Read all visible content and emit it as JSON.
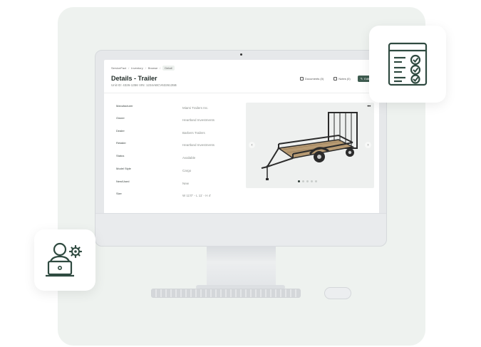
{
  "breadcrumb": [
    "ServiceFact",
    "Inventory",
    "Browse",
    "Detail"
  ],
  "page": {
    "title": "Details - Trailer",
    "subtitle": "Unit ID: 4326-1356   VIN: 1234ABCV6326135B"
  },
  "actions": {
    "documents": "Documents (0)",
    "notes": "Notes (0)",
    "edit": "Edit"
  },
  "fields": [
    {
      "label": "Manufacturer",
      "value": "Miami Trailers Inc."
    },
    {
      "label": "Owner",
      "value": "Heartland Investments"
    },
    {
      "label": "Dealer",
      "value": "Barbers Trailers"
    },
    {
      "label": "Retailer",
      "value": "Heartland Investments"
    },
    {
      "label": "Status",
      "value": "Available"
    },
    {
      "label": "Model Style",
      "value": "Cargo"
    },
    {
      "label": "New/Used",
      "value": "New"
    },
    {
      "label": "Size",
      "value": "W 11'0\" - L 11' - H 4'"
    }
  ],
  "gallery": {
    "more_label": "•••",
    "prev_label": "‹",
    "next_label": "›",
    "dot_count": 5,
    "active_dot": 0
  },
  "icons": {
    "checklist": "checklist-icon",
    "user_settings": "user-laptop-settings-icon"
  },
  "colors": {
    "brand": "#3f5c50",
    "icon_stroke": "#2f4a40",
    "panel": "#eef2ef"
  }
}
